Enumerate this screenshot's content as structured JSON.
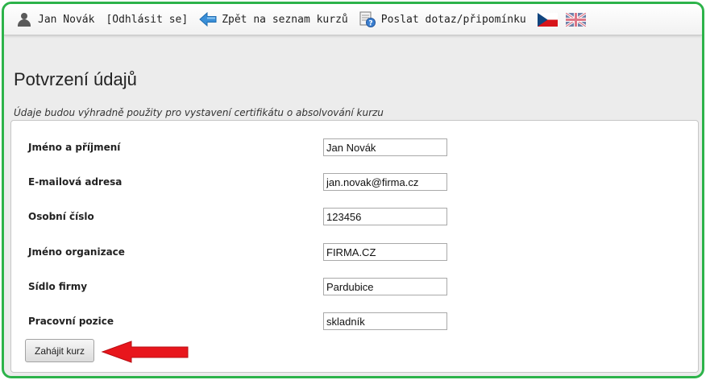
{
  "header": {
    "user_name": "Jan Novák",
    "logout": "[Odhlásit se]",
    "back_to_courses": "Zpět na seznam kurzů",
    "send_question": "Poslat dotaz/připomínku",
    "lang_cs": "cs-flag-icon",
    "lang_en": "uk-flag-icon"
  },
  "page": {
    "title": "Potvrzení údajů",
    "subtitle": "Údaje budou výhradně použity pro vystavení certifikátu o absolvování kurzu"
  },
  "form": {
    "fields": [
      {
        "label": "Jméno a příjmení",
        "value": "Jan Novák"
      },
      {
        "label": "E-mailová adresa",
        "value": "jan.novak@firma.cz"
      },
      {
        "label": "Osobní číslo",
        "value": "123456"
      },
      {
        "label": "Jméno organizace",
        "value": "FIRMA.CZ"
      },
      {
        "label": "Sídlo firmy",
        "value": "Pardubice"
      },
      {
        "label": "Pracovní pozice",
        "value": "skladník"
      }
    ],
    "submit_label": "Zahájit kurz"
  },
  "colors": {
    "frame_border": "#2db34a",
    "arrow": "#e8161c",
    "back_icon": "#3a8fd8"
  }
}
